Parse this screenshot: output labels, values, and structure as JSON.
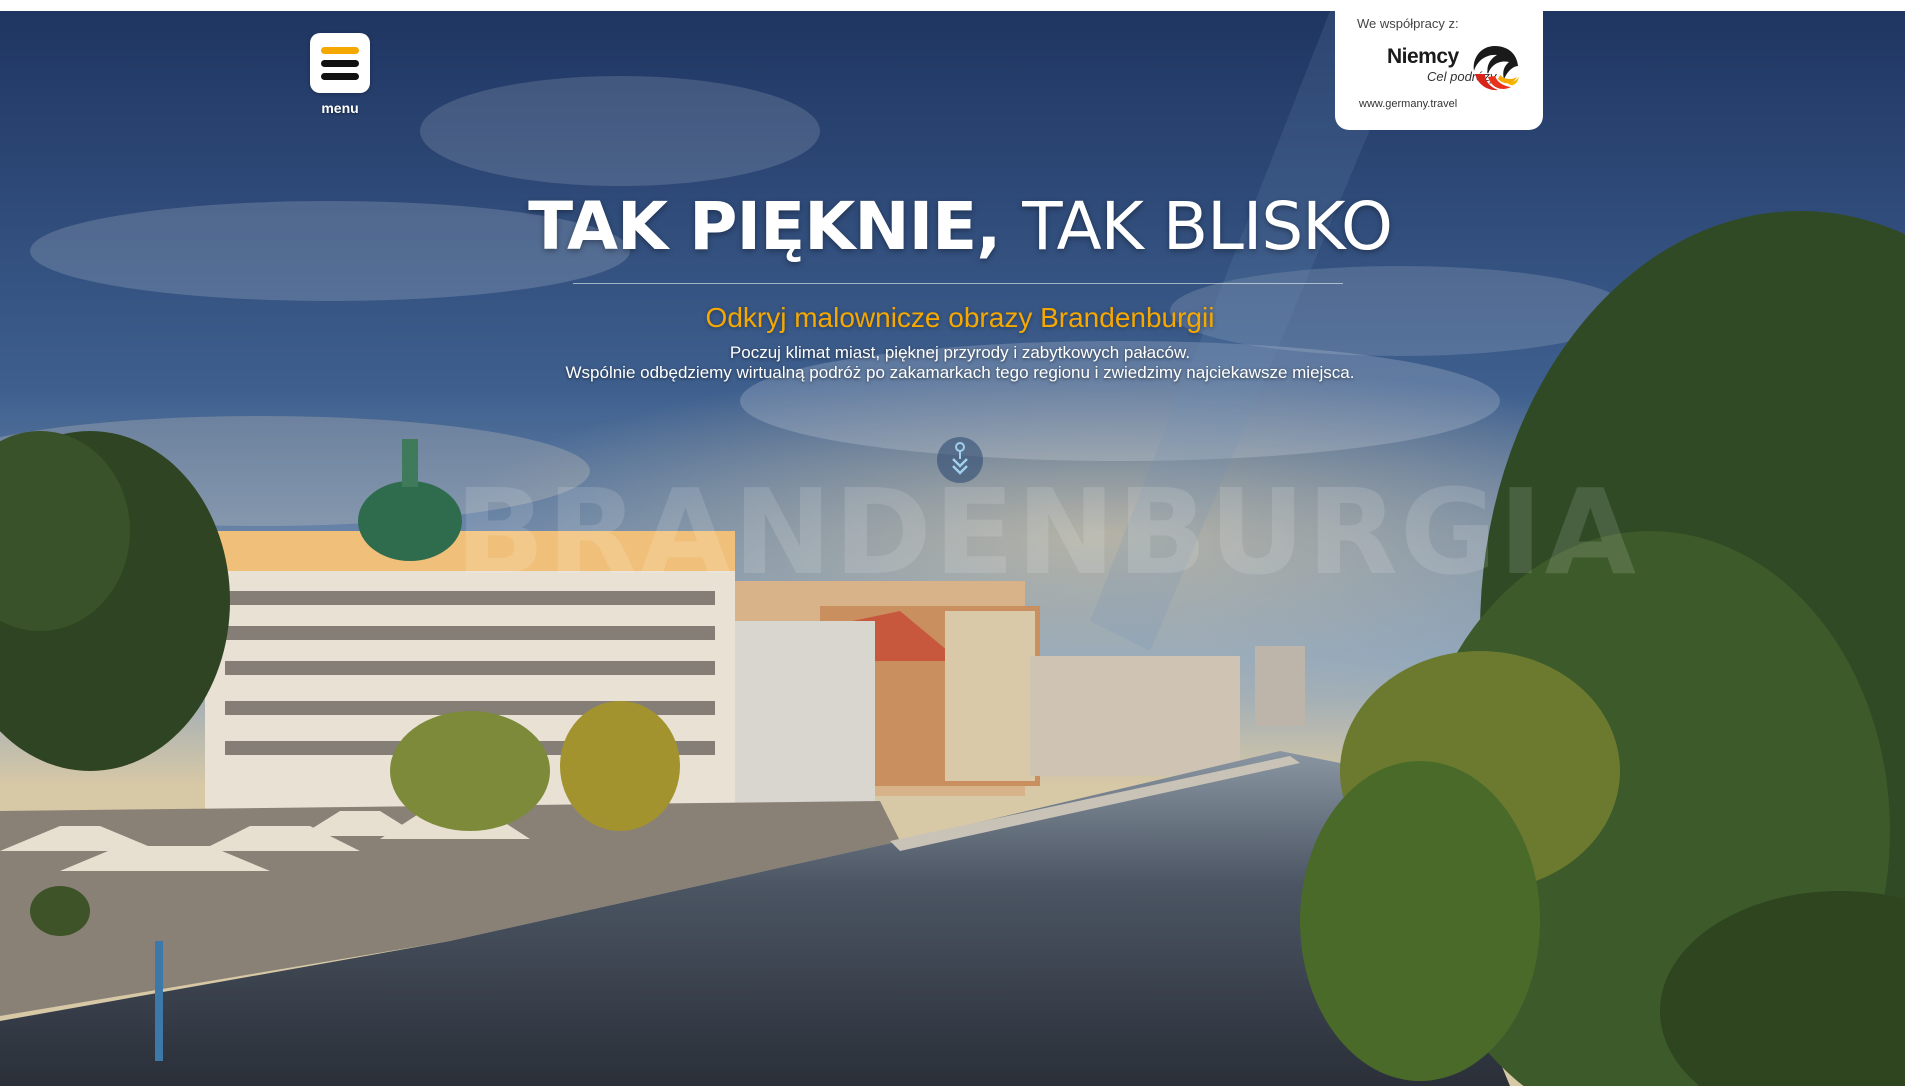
{
  "header": {
    "menu_label": "menu",
    "menu_icon": "hamburger-icon"
  },
  "partner": {
    "cooperation_text": "We współpracy z:",
    "brand": "Niemcy",
    "destination": "Cel podróży",
    "url": "www.germany.travel",
    "logo_icon": "germany-travel-swirl-logo"
  },
  "hero": {
    "title_part1": "TAK PIĘKNIE,",
    "title_part2": "TAK BLISKO",
    "subtitle": "Odkryj malownicze obrazy Brandenburgii",
    "text_line1": "Poczuj klimat miast, pięknej przyrody i zabytkowych pałaców.",
    "text_line2": "Wspólnie odbędziemy wirtualną podróż po zakamarkach tego regionu i zwiedzimy najciekawsze miejsca.",
    "watermark": "BRANDENBURGIA",
    "scroll_icon": "scroll-down-chevron-icon"
  },
  "colors": {
    "accent": "#f5a800",
    "sky_top": "#1f3562",
    "water": "#3a4452",
    "foliage": "#3d5a2a"
  }
}
